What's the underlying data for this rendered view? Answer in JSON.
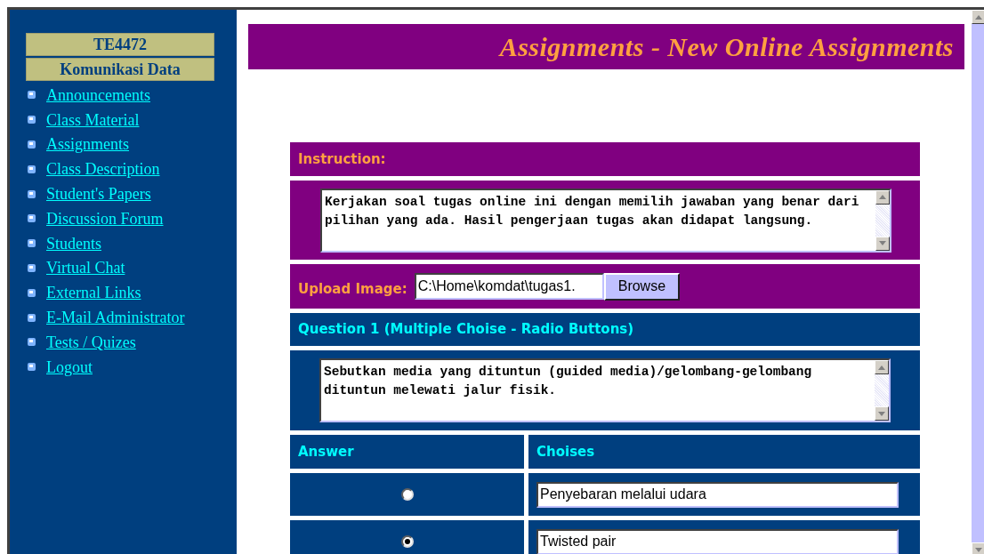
{
  "sidebar": {
    "course_code": "TE4472",
    "course_name": "Komunikasi Data",
    "items": [
      {
        "label": "Announcements"
      },
      {
        "label": "Class Material"
      },
      {
        "label": "Assignments"
      },
      {
        "label": "Class Description"
      },
      {
        "label": "Student's Papers"
      },
      {
        "label": "Discussion Forum"
      },
      {
        "label": "Students"
      },
      {
        "label": "Virtual Chat"
      },
      {
        "label": "External Links"
      },
      {
        "label": "E-Mail Administrator"
      },
      {
        "label": "Tests / Quizes"
      },
      {
        "label": "Logout"
      }
    ]
  },
  "page_title": "Assignments - New Online Assignments",
  "instruction": {
    "heading": "Instruction:",
    "text": "Kerjakan soal tugas online ini dengan memilih jawaban yang benar dari pilihan yang ada. Hasil pengerjaan tugas akan didapat langsung."
  },
  "upload": {
    "label": "Upload Image:",
    "value": "C:\\Home\\komdat\\tugas1.",
    "button": "Browse"
  },
  "question": {
    "heading": "Question 1 (Multiple Choise - Radio Buttons)",
    "text": "Sebutkan media yang dituntun (guided media)/gelombang-gelombang dituntun melewati jalur fisik.",
    "columns": [
      "Answer",
      "Choises"
    ],
    "choices": [
      {
        "value": "Penyebaran melalui udara",
        "selected": false
      },
      {
        "value": "Twisted pair",
        "selected": true
      }
    ]
  }
}
